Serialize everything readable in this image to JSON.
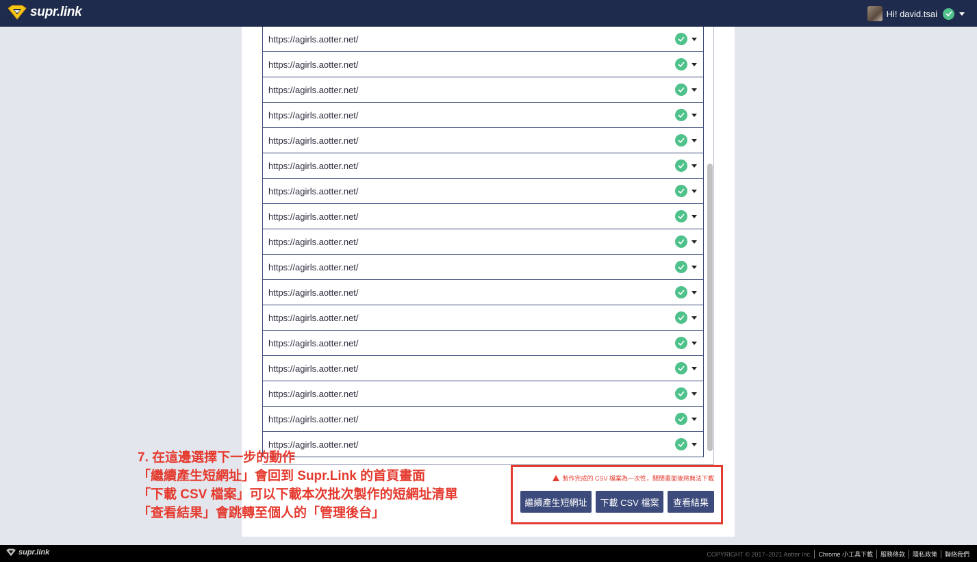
{
  "header": {
    "logo_text": "supr.link",
    "greeting": "Hi! david.tsai"
  },
  "list": {
    "rows": [
      {
        "url": "https://agirls.aotter.net/"
      },
      {
        "url": "https://agirls.aotter.net/"
      },
      {
        "url": "https://agirls.aotter.net/"
      },
      {
        "url": "https://agirls.aotter.net/"
      },
      {
        "url": "https://agirls.aotter.net/"
      },
      {
        "url": "https://agirls.aotter.net/"
      },
      {
        "url": "https://agirls.aotter.net/"
      },
      {
        "url": "https://agirls.aotter.net/"
      },
      {
        "url": "https://agirls.aotter.net/"
      },
      {
        "url": "https://agirls.aotter.net/"
      },
      {
        "url": "https://agirls.aotter.net/"
      },
      {
        "url": "https://agirls.aotter.net/"
      },
      {
        "url": "https://agirls.aotter.net/"
      },
      {
        "url": "https://agirls.aotter.net/"
      },
      {
        "url": "https://agirls.aotter.net/"
      },
      {
        "url": "https://agirls.aotter.net/"
      },
      {
        "url": "https://agirls.aotter.net/"
      }
    ],
    "status_icon": "check-circle-icon",
    "status_color": "#4fc18b"
  },
  "annotation": {
    "lines": [
      "7. 在這邊選擇下一步的動作",
      "「繼續產生短網址」會回到 Supr.Link 的首頁畫面",
      "「下載 CSV 檔案」可以下載本次批次製作的短網址清單",
      "「查看結果」會跳轉至個人的「管理後台」"
    ],
    "color": "#e53a2e"
  },
  "actions": {
    "warning": "製作完成的 CSV 檔案為一次性，關閉畫面後將無法下載",
    "continue_label": "繼續產生短網址",
    "download_label": "下載 CSV 檔案",
    "results_label": "查看結果"
  },
  "footer": {
    "logo_text": "supr.link",
    "copyright": "COPYRIGHT © 2017–2021 Aotter Inc.",
    "links": [
      "Chrome 小工具下載",
      "服務條款",
      "隱私政策",
      "聯絡我們"
    ]
  },
  "colors": {
    "navbar": "#1f2b4c",
    "button": "#3d4b7c",
    "accent_yellow": "#f5c518"
  }
}
